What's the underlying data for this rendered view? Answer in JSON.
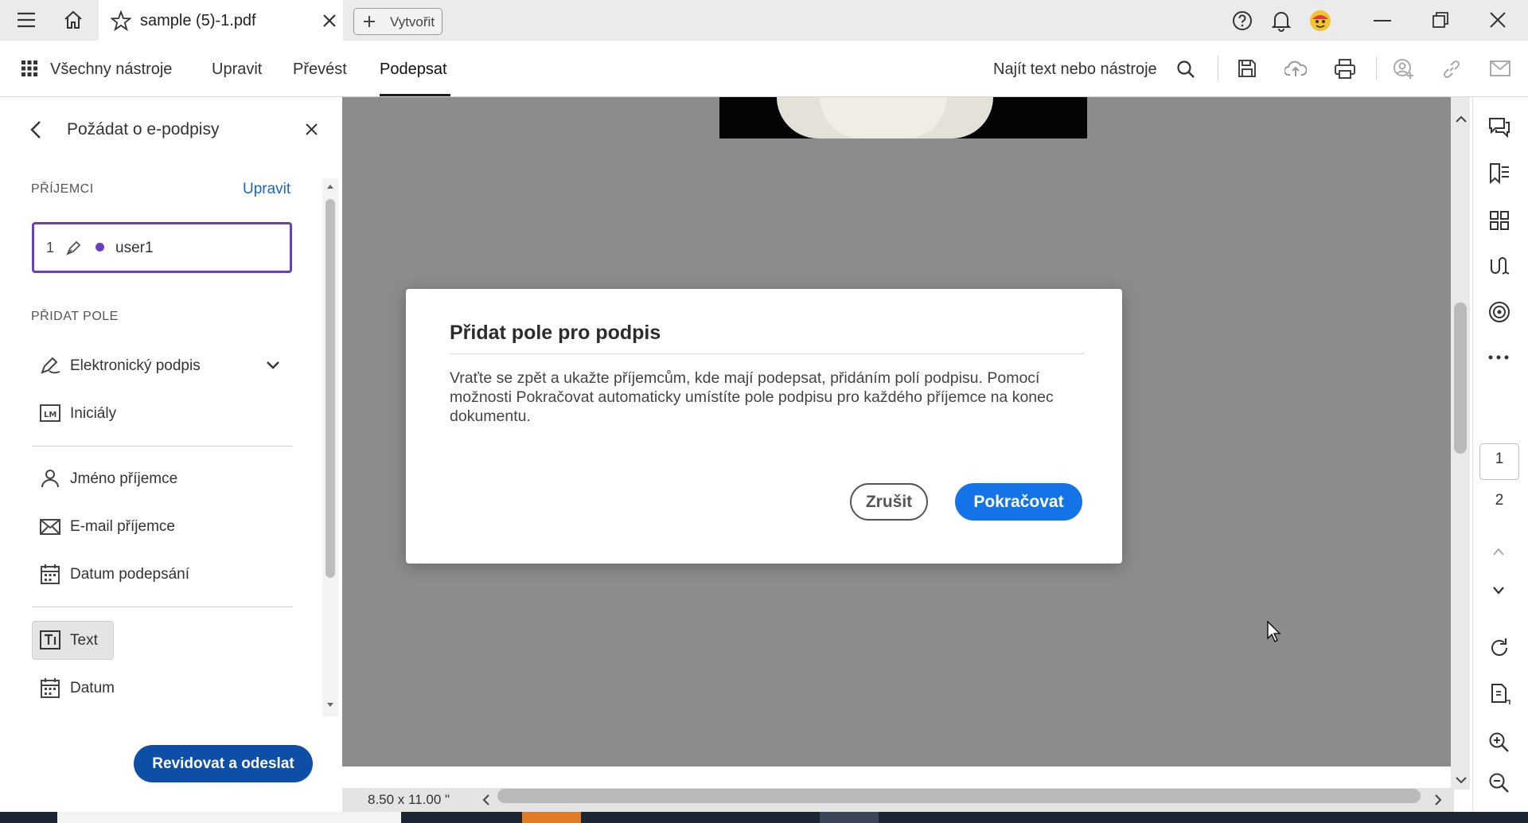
{
  "window": {
    "tab_title": "sample (5)-1.pdf",
    "create_label": "Vytvořit"
  },
  "toolbar": {
    "all_tools_label": "Všechny nástroje",
    "menu_items": [
      "Upravit",
      "Převést",
      "Podepsat"
    ],
    "active_menu": "Podepsat",
    "search_label": "Najít text nebo nástroje"
  },
  "left_panel": {
    "title": "Požádat o e-podpisy",
    "recipients_header": "PŘÍJEMCI",
    "edit_link": "Upravit",
    "recipient": {
      "number": "1",
      "name": "user1",
      "dot_color": "#6a3fbf"
    },
    "add_field_header": "PŘIDAT POLE",
    "fields": [
      {
        "label": "Elektronický podpis",
        "icon": "signature-pen-icon"
      },
      {
        "label": "Iniciály",
        "icon": "initials-icon"
      },
      {
        "label": "Jméno příjemce",
        "icon": "person-icon"
      },
      {
        "label": "E-mail příjemce",
        "icon": "envelope-icon"
      },
      {
        "label": "Datum podepsání",
        "icon": "calendar-icon"
      },
      {
        "label": "Text",
        "icon": "text-field-icon"
      },
      {
        "label": "Datum",
        "icon": "calendar-icon"
      }
    ],
    "review_button": "Revidovat a odeslat"
  },
  "dialog": {
    "title": "Přidat pole pro podpis",
    "body": "Vraťte se zpět a ukažte příjemcům, kde mají podepsat, přidáním polí podpisu. Pomocí možnosti Pokračovat automaticky umístíte pole podpisu pro každého příjemce na konec dokumentu.",
    "cancel_label": "Zrušit",
    "continue_label": "Pokračovat"
  },
  "document": {
    "page_size": "8.50 x 11.00 \"",
    "pages": [
      "1",
      "2"
    ],
    "current_page": "1"
  },
  "colors": {
    "accent_blue": "#1473e6",
    "review_button": "#0d4ea6",
    "recipient_purple": "#6a3fbf",
    "doc_background": "#8c8c8c"
  }
}
